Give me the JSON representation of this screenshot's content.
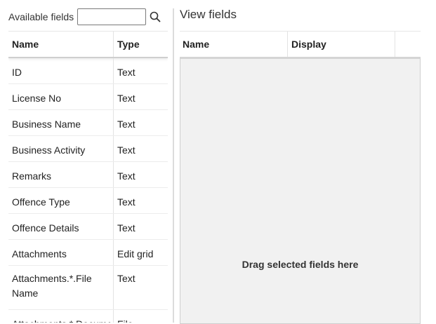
{
  "available": {
    "label": "Available fields",
    "search_value": "",
    "columns": {
      "name": "Name",
      "type": "Type"
    },
    "rows": [
      {
        "name": "ID",
        "type": "Text"
      },
      {
        "name": "License No",
        "type": "Text"
      },
      {
        "name": "Business Name",
        "type": "Text"
      },
      {
        "name": "Business Activity",
        "type": "Text"
      },
      {
        "name": "Remarks",
        "type": "Text"
      },
      {
        "name": "Offence Type",
        "type": "Text"
      },
      {
        "name": "Offence Details",
        "type": "Text"
      },
      {
        "name": "Attachments",
        "type": "Edit grid"
      },
      {
        "name": "Attachments.*.File Name",
        "type": "Text"
      },
      {
        "name": "Attachments.*.Document",
        "type": "File"
      }
    ]
  },
  "view": {
    "title": "View fields",
    "columns": {
      "name": "Name",
      "display": "Display"
    },
    "drop_hint": "Drag selected fields here"
  },
  "colors": {
    "dropzone_bg": "#f1f1f1",
    "header_border": "#cfcfcf"
  }
}
